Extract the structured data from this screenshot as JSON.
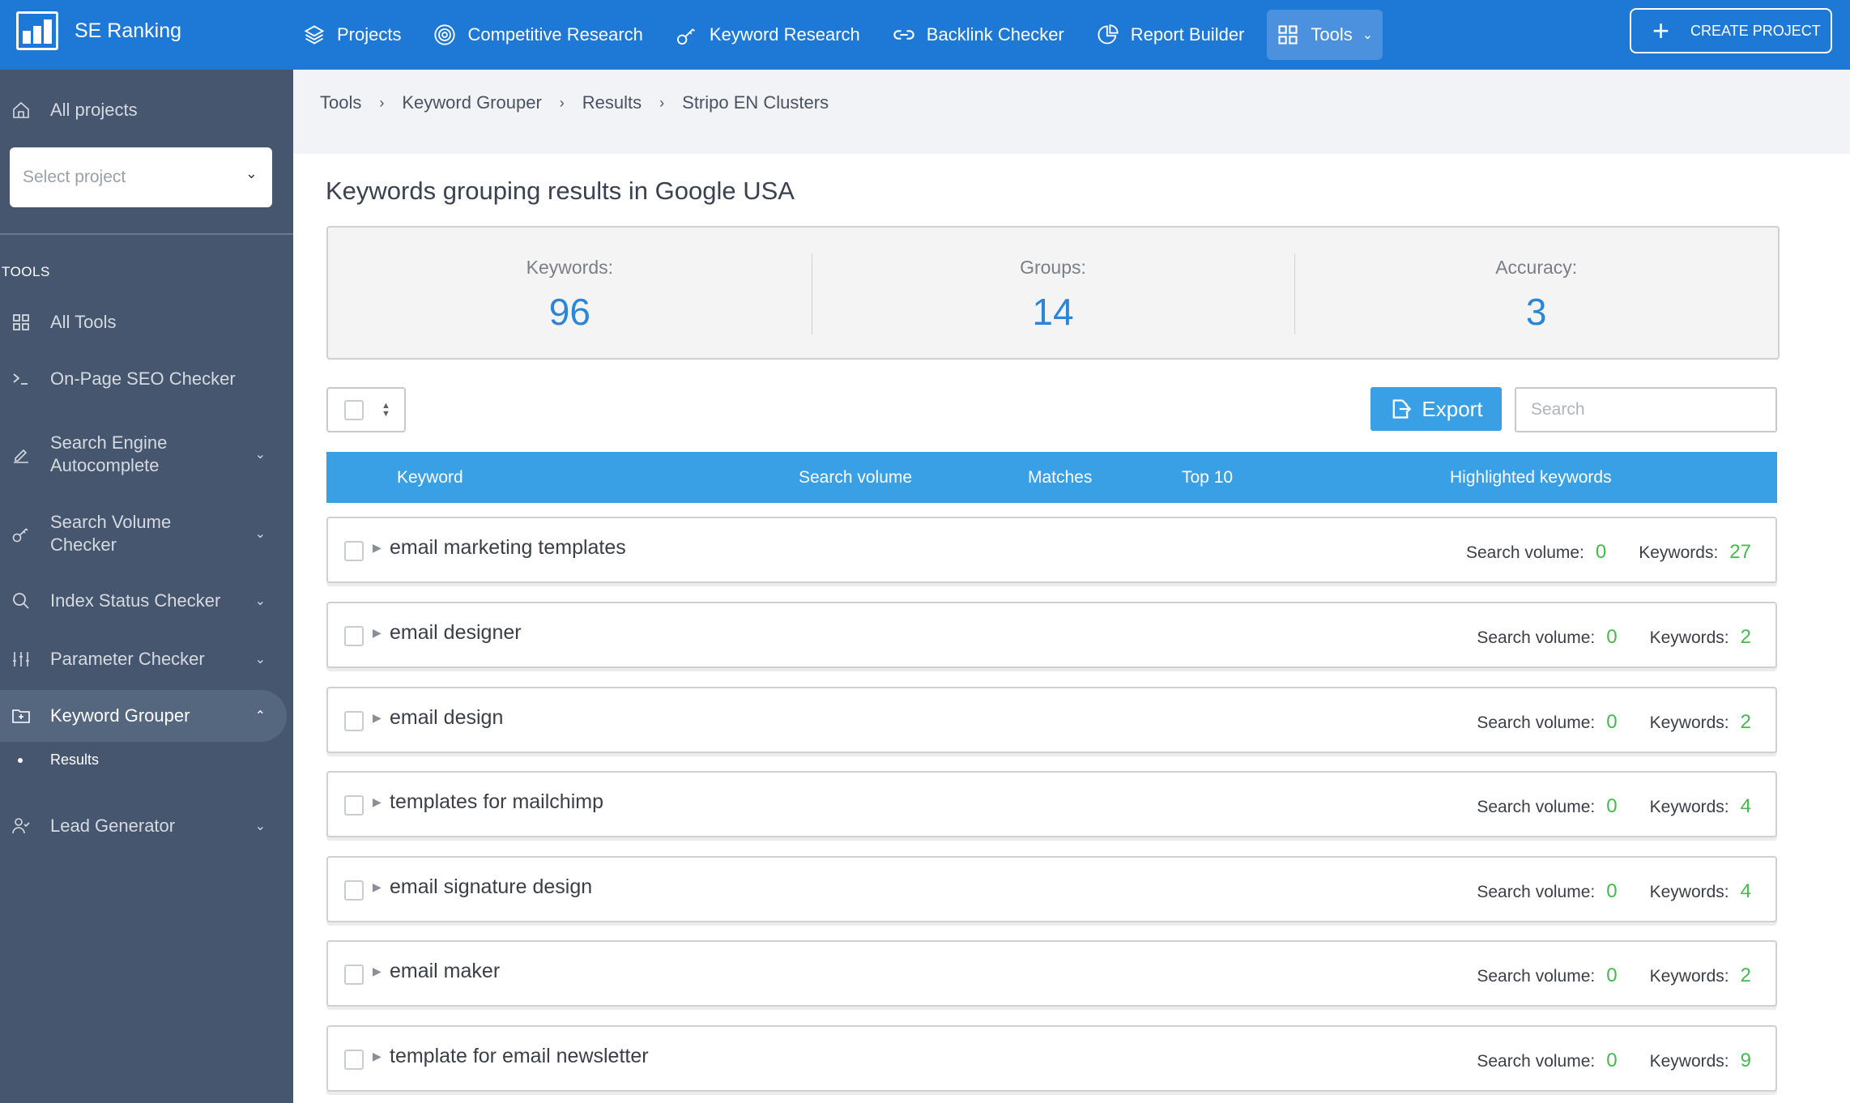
{
  "app": {
    "name": "SE Ranking"
  },
  "nav": {
    "items": [
      {
        "label": "Projects",
        "icon": "layers-icon"
      },
      {
        "label": "Competitive Research",
        "icon": "target-icon"
      },
      {
        "label": "Keyword Research",
        "icon": "key-icon"
      },
      {
        "label": "Backlink Checker",
        "icon": "link-icon"
      },
      {
        "label": "Report Builder",
        "icon": "pie-chart-icon"
      },
      {
        "label": "Tools",
        "icon": "grid-icon",
        "active": true
      }
    ],
    "create_project": "CREATE PROJECT"
  },
  "sidebar": {
    "all_projects": "All projects",
    "select_project_placeholder": "Select project",
    "section_title": "TOOLS",
    "items": [
      {
        "label": "All Tools",
        "icon": "grid-icon"
      },
      {
        "label": "On-Page SEO Checker",
        "icon": "terminal-icon"
      },
      {
        "label": "Search Engine Autocomplete",
        "icon": "pencil-icon",
        "expandable": true
      },
      {
        "label": "Search Volume Checker",
        "icon": "key-icon",
        "expandable": true
      },
      {
        "label": "Index Status Checker",
        "icon": "search-icon",
        "expandable": true
      },
      {
        "label": "Parameter Checker",
        "icon": "sliders-icon",
        "expandable": true
      },
      {
        "label": "Keyword Grouper",
        "icon": "folder-plus-icon",
        "expandable": true,
        "active": true
      },
      {
        "label": "Lead Generator",
        "icon": "user-check-icon",
        "expandable": true
      }
    ],
    "sub_item": "Results"
  },
  "breadcrumb": [
    "Tools",
    "Keyword Grouper",
    "Results",
    "Stripo EN Clusters"
  ],
  "page_title": "Keywords grouping results in Google USA",
  "stats": [
    {
      "label": "Keywords:",
      "value": "96"
    },
    {
      "label": "Groups:",
      "value": "14"
    },
    {
      "label": "Accuracy:",
      "value": "3"
    }
  ],
  "toolbar": {
    "export_label": "Export",
    "search_placeholder": "Search"
  },
  "table": {
    "columns": [
      "Keyword",
      "Search volume",
      "Matches",
      "Top 10",
      "Highlighted keywords"
    ],
    "search_volume_label": "Search volume:",
    "keywords_label": "Keywords:",
    "rows": [
      {
        "keyword": "email marketing templates",
        "search_volume": "0",
        "keywords": "27"
      },
      {
        "keyword": "email designer",
        "search_volume": "0",
        "keywords": "2"
      },
      {
        "keyword": "email design",
        "search_volume": "0",
        "keywords": "2"
      },
      {
        "keyword": "templates for mailchimp",
        "search_volume": "0",
        "keywords": "4"
      },
      {
        "keyword": "email signature design",
        "search_volume": "0",
        "keywords": "4"
      },
      {
        "keyword": "email maker",
        "search_volume": "0",
        "keywords": "2"
      },
      {
        "keyword": "template for email newsletter",
        "search_volume": "0",
        "keywords": "9"
      }
    ]
  },
  "colors": {
    "header": "#1e78d5",
    "sidebar": "#46566f",
    "accent": "#3aa0e6",
    "stat_value": "#2c86d8",
    "positive": "#46b94e"
  }
}
